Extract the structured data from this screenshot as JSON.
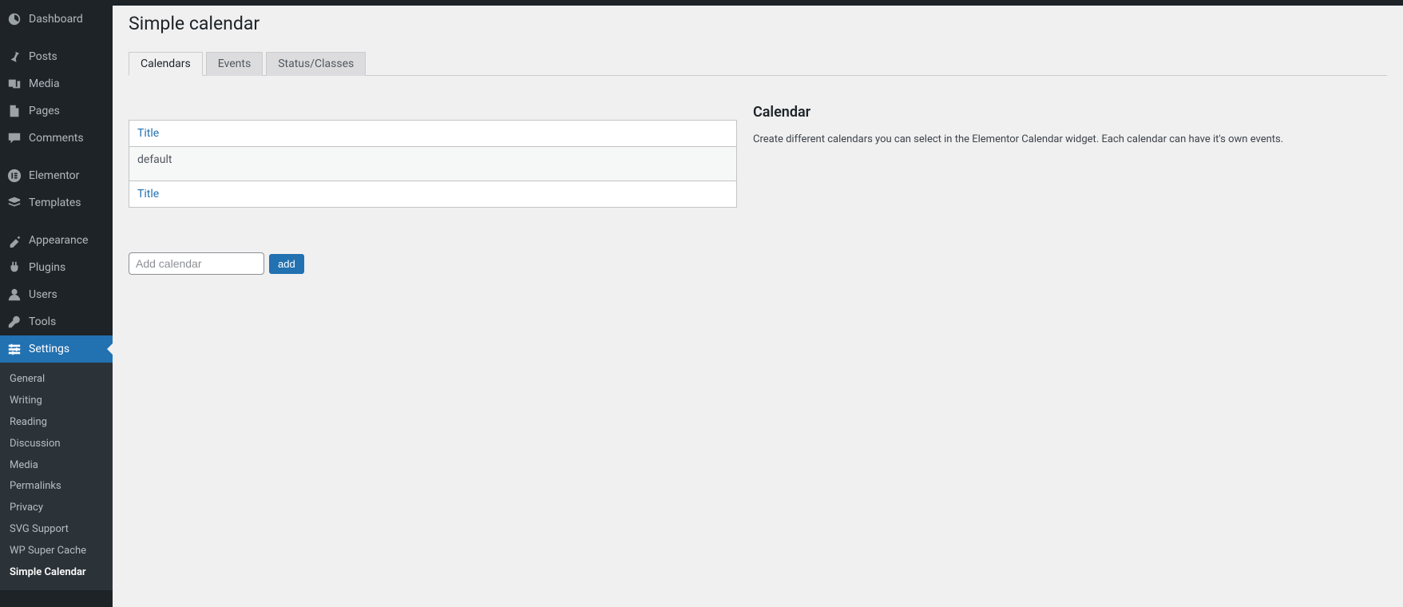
{
  "sidebar": {
    "groups": [
      [
        {
          "icon": "dashboard",
          "label": "Dashboard",
          "key": "dashboard"
        }
      ],
      [
        {
          "icon": "pin",
          "label": "Posts",
          "key": "posts"
        },
        {
          "icon": "media",
          "label": "Media",
          "key": "media"
        },
        {
          "icon": "page",
          "label": "Pages",
          "key": "pages"
        },
        {
          "icon": "comment",
          "label": "Comments",
          "key": "comments"
        }
      ],
      [
        {
          "icon": "elementor",
          "label": "Elementor",
          "key": "elementor"
        },
        {
          "icon": "templates",
          "label": "Templates",
          "key": "templates"
        }
      ],
      [
        {
          "icon": "appearance",
          "label": "Appearance",
          "key": "appearance"
        },
        {
          "icon": "plugin",
          "label": "Plugins",
          "key": "plugins"
        },
        {
          "icon": "user",
          "label": "Users",
          "key": "users"
        },
        {
          "icon": "tool",
          "label": "Tools",
          "key": "tools"
        },
        {
          "icon": "settings",
          "label": "Settings",
          "key": "settings",
          "current": true
        }
      ]
    ],
    "submenu": [
      {
        "label": "General"
      },
      {
        "label": "Writing"
      },
      {
        "label": "Reading"
      },
      {
        "label": "Discussion"
      },
      {
        "label": "Media"
      },
      {
        "label": "Permalinks"
      },
      {
        "label": "Privacy"
      },
      {
        "label": "SVG Support"
      },
      {
        "label": "WP Super Cache"
      },
      {
        "label": "Simple Calendar",
        "current": true
      }
    ]
  },
  "page": {
    "title": "Simple calendar",
    "tabs": [
      {
        "label": "Calendars",
        "active": true
      },
      {
        "label": "Events"
      },
      {
        "label": "Status/Classes"
      }
    ]
  },
  "table": {
    "column_header": "Title",
    "column_footer": "Title",
    "rows": [
      {
        "title": "default"
      }
    ]
  },
  "sidepanel": {
    "heading": "Calendar",
    "description": "Create different calendars you can select in the Elementor Calendar widget. Each calendar can have it's own events."
  },
  "add_form": {
    "placeholder": "Add calendar",
    "button_label": "add"
  },
  "colors": {
    "accent": "#2271b1",
    "sidebar_bg": "#1d2327",
    "body_bg": "#f0f0f1"
  }
}
